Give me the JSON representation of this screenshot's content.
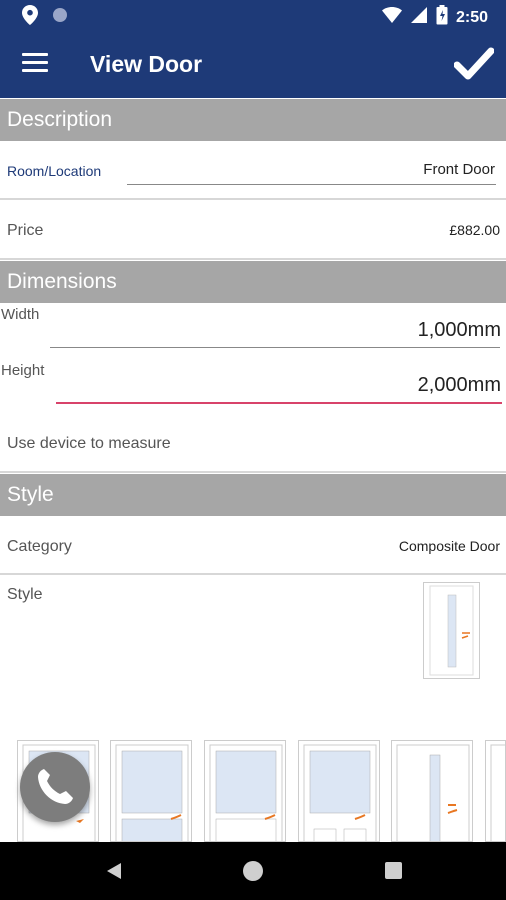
{
  "status_bar": {
    "time": "2:50"
  },
  "app_bar": {
    "title": "View Door"
  },
  "description": {
    "header": "Description",
    "room_location_label": "Room/Location",
    "room_location_value": "Front Door",
    "price_label": "Price",
    "price_value": "£882.00"
  },
  "dimensions": {
    "header": "Dimensions",
    "width_label": "Width",
    "width_value": "1,000mm",
    "height_label": "Height",
    "height_value": "2,000mm",
    "measure_label": "Use device to measure"
  },
  "style": {
    "header": "Style",
    "category_label": "Category",
    "category_value": "Composite Door",
    "style_label": "Style"
  },
  "colors": {
    "primary": "#1e3a78",
    "section_header": "#a6a6a6",
    "active_underline": "#d8436a",
    "glass": "#dce6f4",
    "handle": "#e87722"
  }
}
